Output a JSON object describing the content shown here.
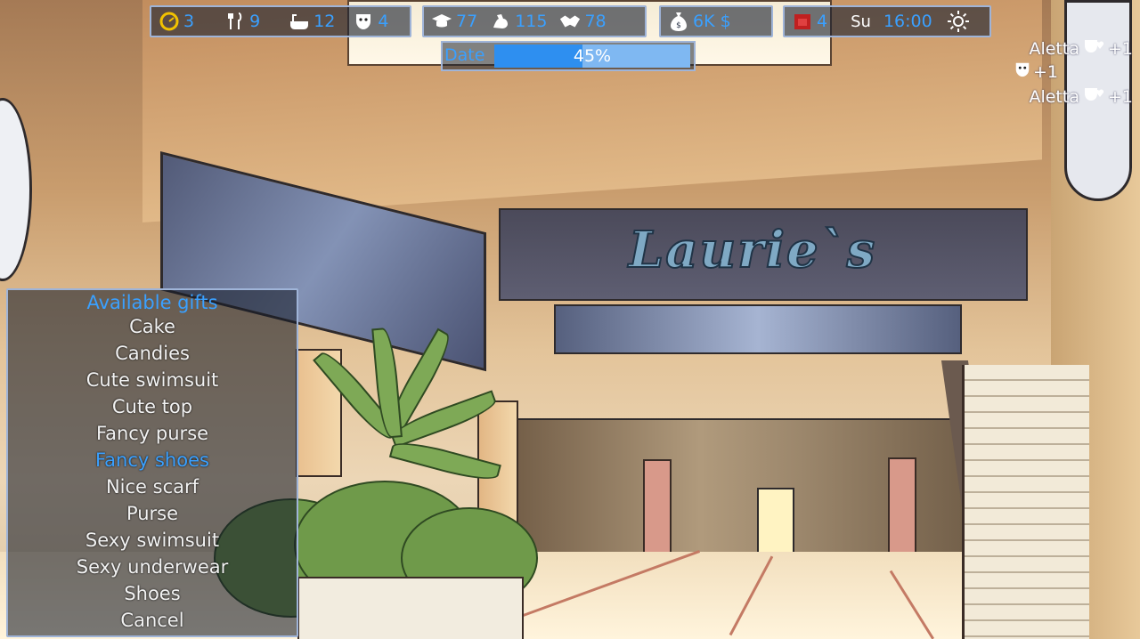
{
  "hud": {
    "stats": [
      {
        "icon": "energy-gauge-icon",
        "value": "3"
      },
      {
        "icon": "fork-knife-icon",
        "value": "9"
      },
      {
        "icon": "bathtub-icon",
        "value": "12"
      },
      {
        "icon": "mask-icon",
        "value": "4"
      }
    ],
    "skills": [
      {
        "icon": "graduation-cap-icon",
        "value": "77"
      },
      {
        "icon": "muscle-arm-icon",
        "value": "115"
      },
      {
        "icon": "handshake-icon",
        "value": "78"
      }
    ],
    "money": {
      "icon": "money-bag-icon",
      "value": "6K $"
    },
    "time": {
      "icon": "calendar-icon",
      "day_number": "4",
      "weekday": "Su",
      "clock": "16:00",
      "weather_icon": "sun-icon"
    }
  },
  "date_bar": {
    "label": "Date",
    "progress": 45,
    "progress_text": "45%"
  },
  "notifications": [
    {
      "name": "Aletta",
      "icon": "heart-mask-icon",
      "delta": "+1"
    },
    {
      "name": "",
      "icon": "mask-icon",
      "delta": "+1"
    },
    {
      "name": "Aletta",
      "icon": "heart-mask-icon",
      "delta": "+1"
    }
  ],
  "scene": {
    "shop_sign": "Laurie`s"
  },
  "gift_menu": {
    "title": "Available gifts",
    "items": [
      "Cake",
      "Candies",
      "Cute swimsuit",
      "Cute top",
      "Fancy purse",
      "Fancy shoes",
      "Nice scarf",
      "Purse",
      "Sexy swimsuit",
      "Sexy underwear",
      "Shoes",
      "Cancel"
    ],
    "selected_index": 5
  },
  "colors": {
    "accent": "#3aa0ff",
    "panel_border": "#9fb4d8",
    "progress_fill": "#2e8ff0"
  }
}
